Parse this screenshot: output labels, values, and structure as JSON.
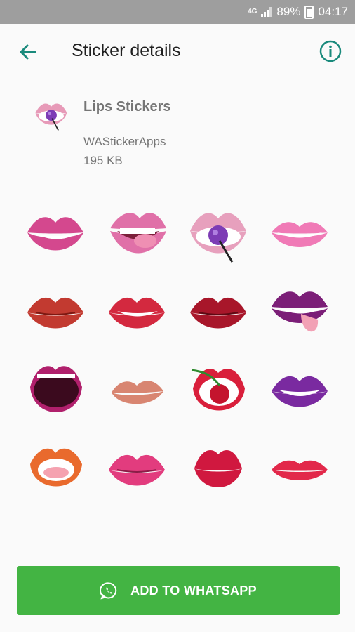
{
  "status_bar": {
    "network": "4G",
    "battery": "89%",
    "time": "04:17"
  },
  "app_bar": {
    "title": "Sticker details",
    "back_icon": "arrow-left-icon",
    "info_icon": "info-icon"
  },
  "pack": {
    "name": "Lips Stickers",
    "publisher": "WAStickerApps",
    "size": "195 KB",
    "tray_icon": "lips-lollipop-icon"
  },
  "stickers": [
    "pink-lips-smile",
    "pink-lips-tongue-bite",
    "lips-purple-lollipop",
    "pink-lips-grin",
    "red-lips-kiss",
    "red-lips-bite",
    "dark-red-lips",
    "purple-lips-tongue",
    "magenta-lips-open",
    "nude-lips-pout",
    "red-lips-cherry",
    "purple-lips-smile",
    "orange-lips-open",
    "pink-lips-closed",
    "red-lips-pucker",
    "red-lips-thin"
  ],
  "colors": {
    "accent": "#1a8a7c",
    "button": "#43b443",
    "status_bar": "#9e9e9e"
  },
  "add_button": {
    "label": "ADD TO WHATSAPP",
    "icon": "whatsapp-icon"
  }
}
